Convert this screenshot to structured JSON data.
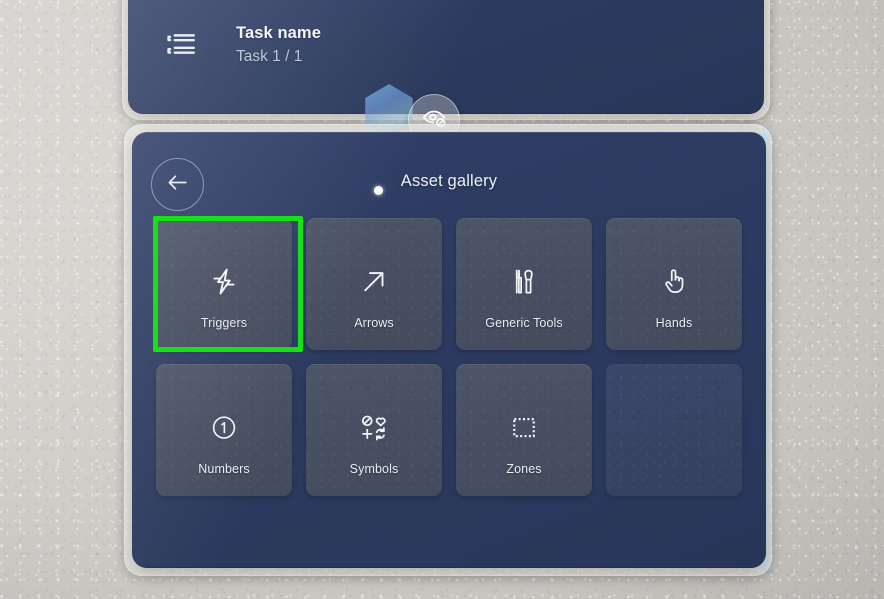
{
  "scene": {
    "environment": "textured-wall",
    "accent_green": "#18e018",
    "panel_blue": "#2b3a5e",
    "tile_gray": "#4a5265",
    "glow_cyan": "#a8e6ff"
  },
  "task_panel": {
    "icon": "task-list-icon",
    "title": "Task name",
    "subtitle": "Task 1 / 1"
  },
  "floating_controls": {
    "gem": "holographic-gem",
    "eye_toggle": {
      "icon": "eye-off-icon",
      "label": "Toggle visibility"
    }
  },
  "gallery": {
    "back_button": {
      "icon": "arrow-left-icon",
      "label": "Back"
    },
    "title": "Asset gallery",
    "cursor": "gaze-cursor",
    "tiles": [
      {
        "label": "Triggers",
        "icon": "lightning-bolt-icon",
        "selected": true,
        "empty": false
      },
      {
        "label": "Arrows",
        "icon": "arrow-up-right-icon",
        "selected": false,
        "empty": false
      },
      {
        "label": "Generic Tools",
        "icon": "tools-icon",
        "selected": false,
        "empty": false
      },
      {
        "label": "Hands",
        "icon": "pointing-hand-icon",
        "selected": false,
        "empty": false
      },
      {
        "label": "Numbers",
        "icon": "circle-one-icon",
        "selected": false,
        "empty": false
      },
      {
        "label": "Symbols",
        "icon": "symbols-grid-icon",
        "selected": false,
        "empty": false
      },
      {
        "label": "Zones",
        "icon": "dashed-square-icon",
        "selected": false,
        "empty": false
      },
      {
        "label": "",
        "icon": "",
        "selected": false,
        "empty": true
      }
    ]
  }
}
